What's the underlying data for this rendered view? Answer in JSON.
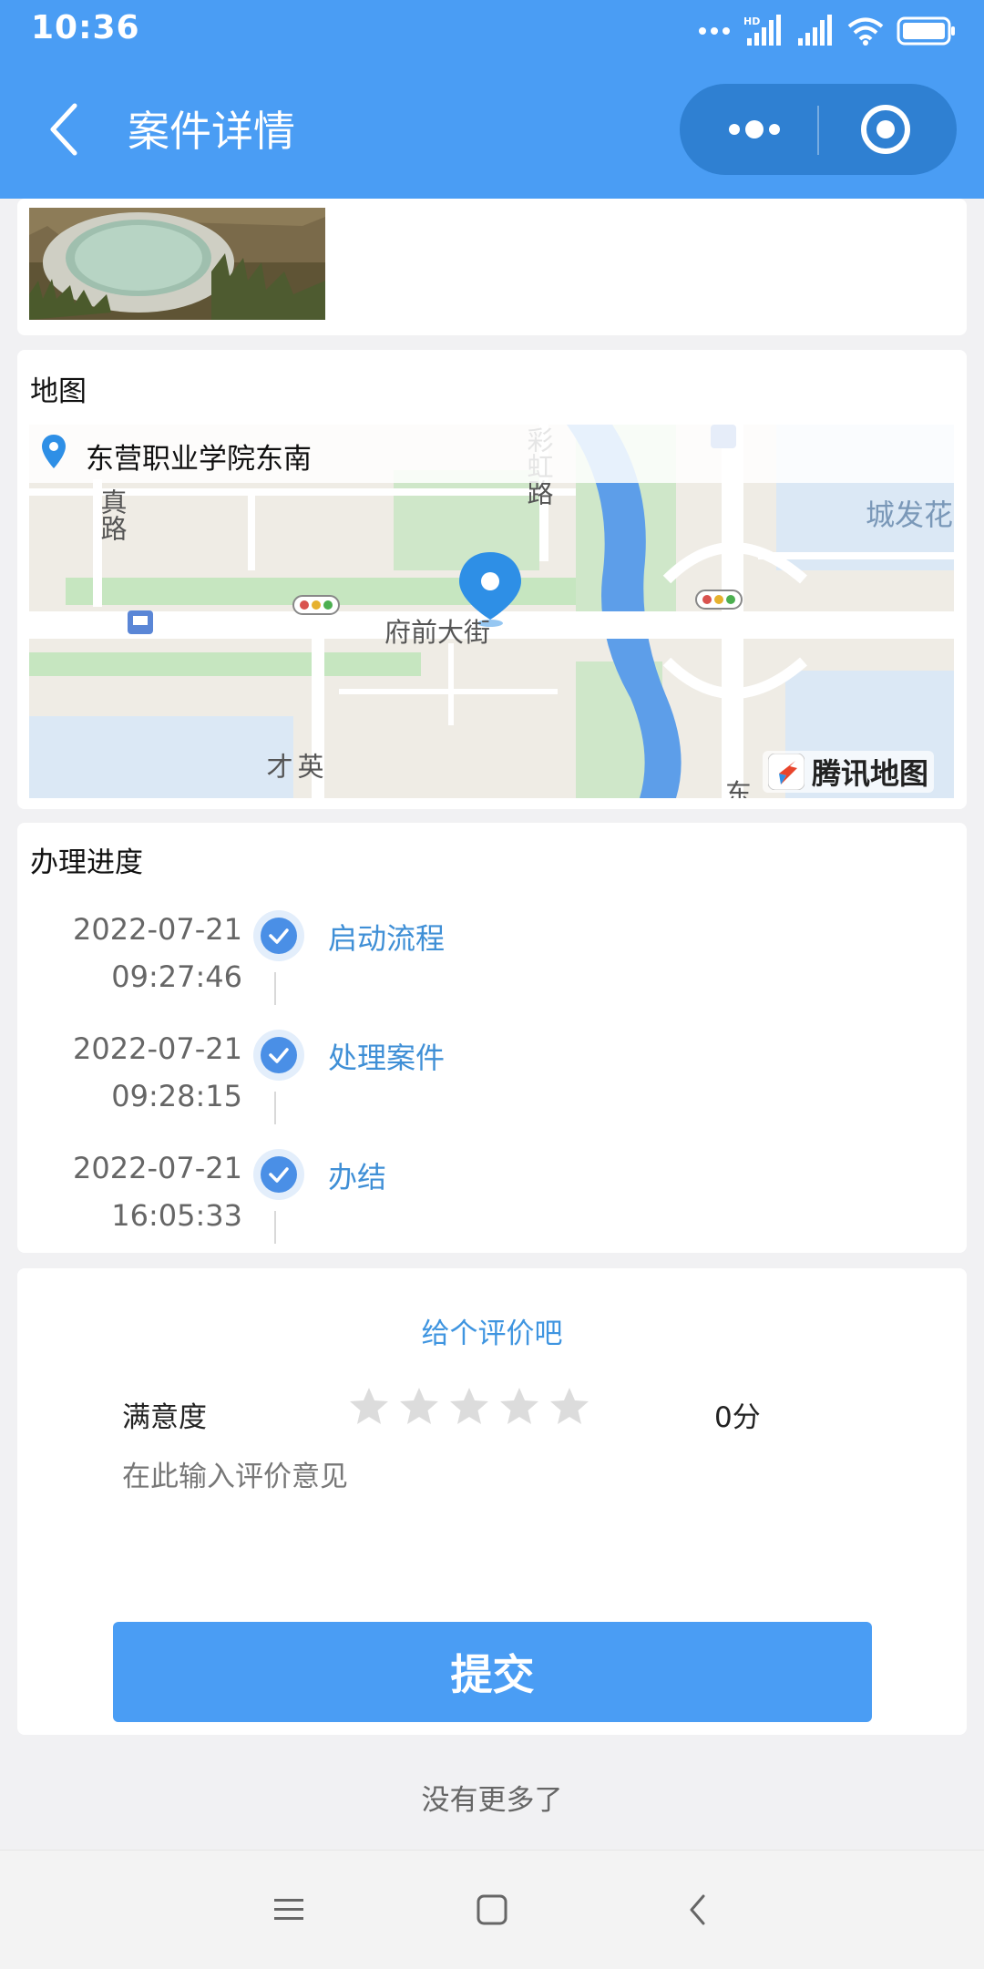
{
  "status_bar": {
    "time": "10:36",
    "network_badge": "HD",
    "icons": [
      "dots-icon",
      "signal-hd-icon",
      "signal-icon",
      "wifi-icon",
      "battery-icon"
    ]
  },
  "nav": {
    "title": "案件详情",
    "back_icon": "chevron-left-icon",
    "capsule_icons": [
      "more-dots-icon",
      "close-target-icon"
    ]
  },
  "map_card": {
    "title": "地图",
    "location": "东营职业学院东南",
    "road_labels": [
      "彩虹路",
      "真路",
      "府前大街",
      "城发花",
      "英才",
      "东"
    ],
    "logo_text": "腾讯地图"
  },
  "progress_card": {
    "title": "办理进度",
    "steps": [
      {
        "date": "2022-07-21",
        "time": "09:27:46",
        "label": "启动流程"
      },
      {
        "date": "2022-07-21",
        "time": "09:28:15",
        "label": "处理案件"
      },
      {
        "date": "2022-07-21",
        "time": "16:05:33",
        "label": "办结"
      }
    ]
  },
  "rating_card": {
    "title": "给个评价吧",
    "satisfaction_label": "满意度",
    "stars_total": 5,
    "stars_filled": 0,
    "score": "0分",
    "comment_placeholder": "在此输入评价意见",
    "submit_label": "提交"
  },
  "footer": {
    "no_more": "没有更多了"
  },
  "colors": {
    "brand_blue": "#4a9df4",
    "capsule_blue": "#2f80d2",
    "link_blue": "#3f8fd6",
    "page_bg": "#f1f1f3"
  }
}
